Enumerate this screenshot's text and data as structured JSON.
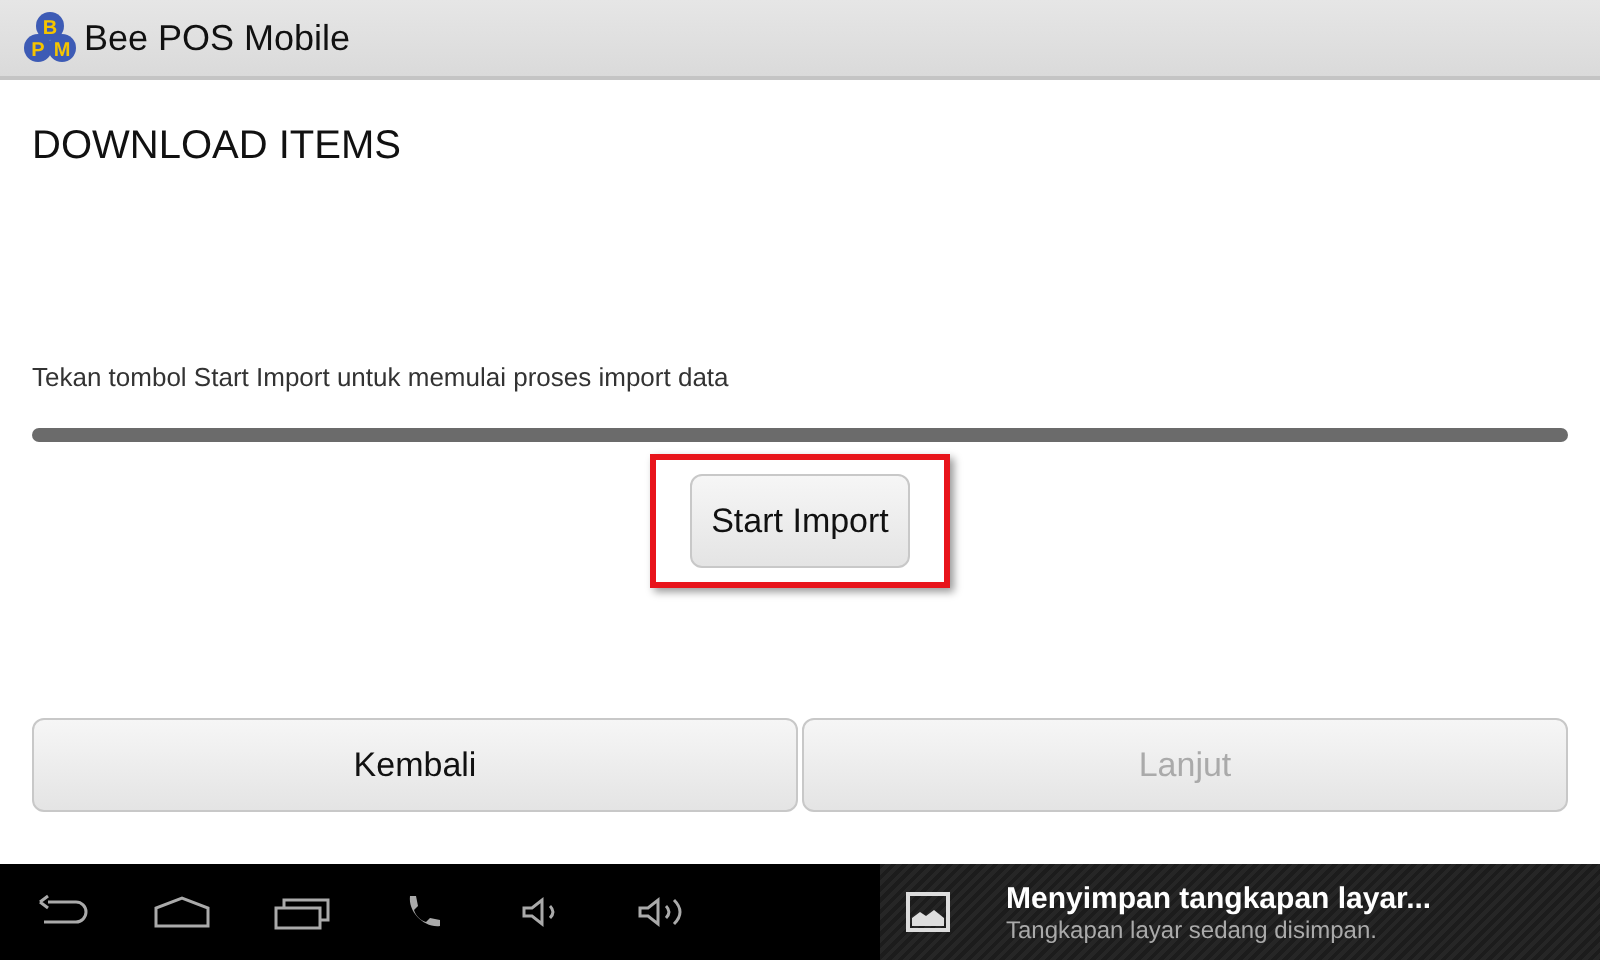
{
  "app_bar": {
    "logo_letters": [
      "B",
      "P",
      "M"
    ],
    "title": "Bee POS Mobile"
  },
  "heading": "DOWNLOAD ITEMS",
  "instruction": "Tekan tombol Start Import untuk memulai proses import data",
  "progress": {
    "level": 0
  },
  "start_button": {
    "label": "Start Import",
    "highlighted": true
  },
  "actions": [
    {
      "label": "Kembali",
      "disabled": false
    },
    {
      "label": "Lanjut",
      "disabled": true
    }
  ],
  "notification": {
    "title": "Menyimpan tangkapan layar...",
    "text": "Tangkapan layar sedang disimpan."
  }
}
